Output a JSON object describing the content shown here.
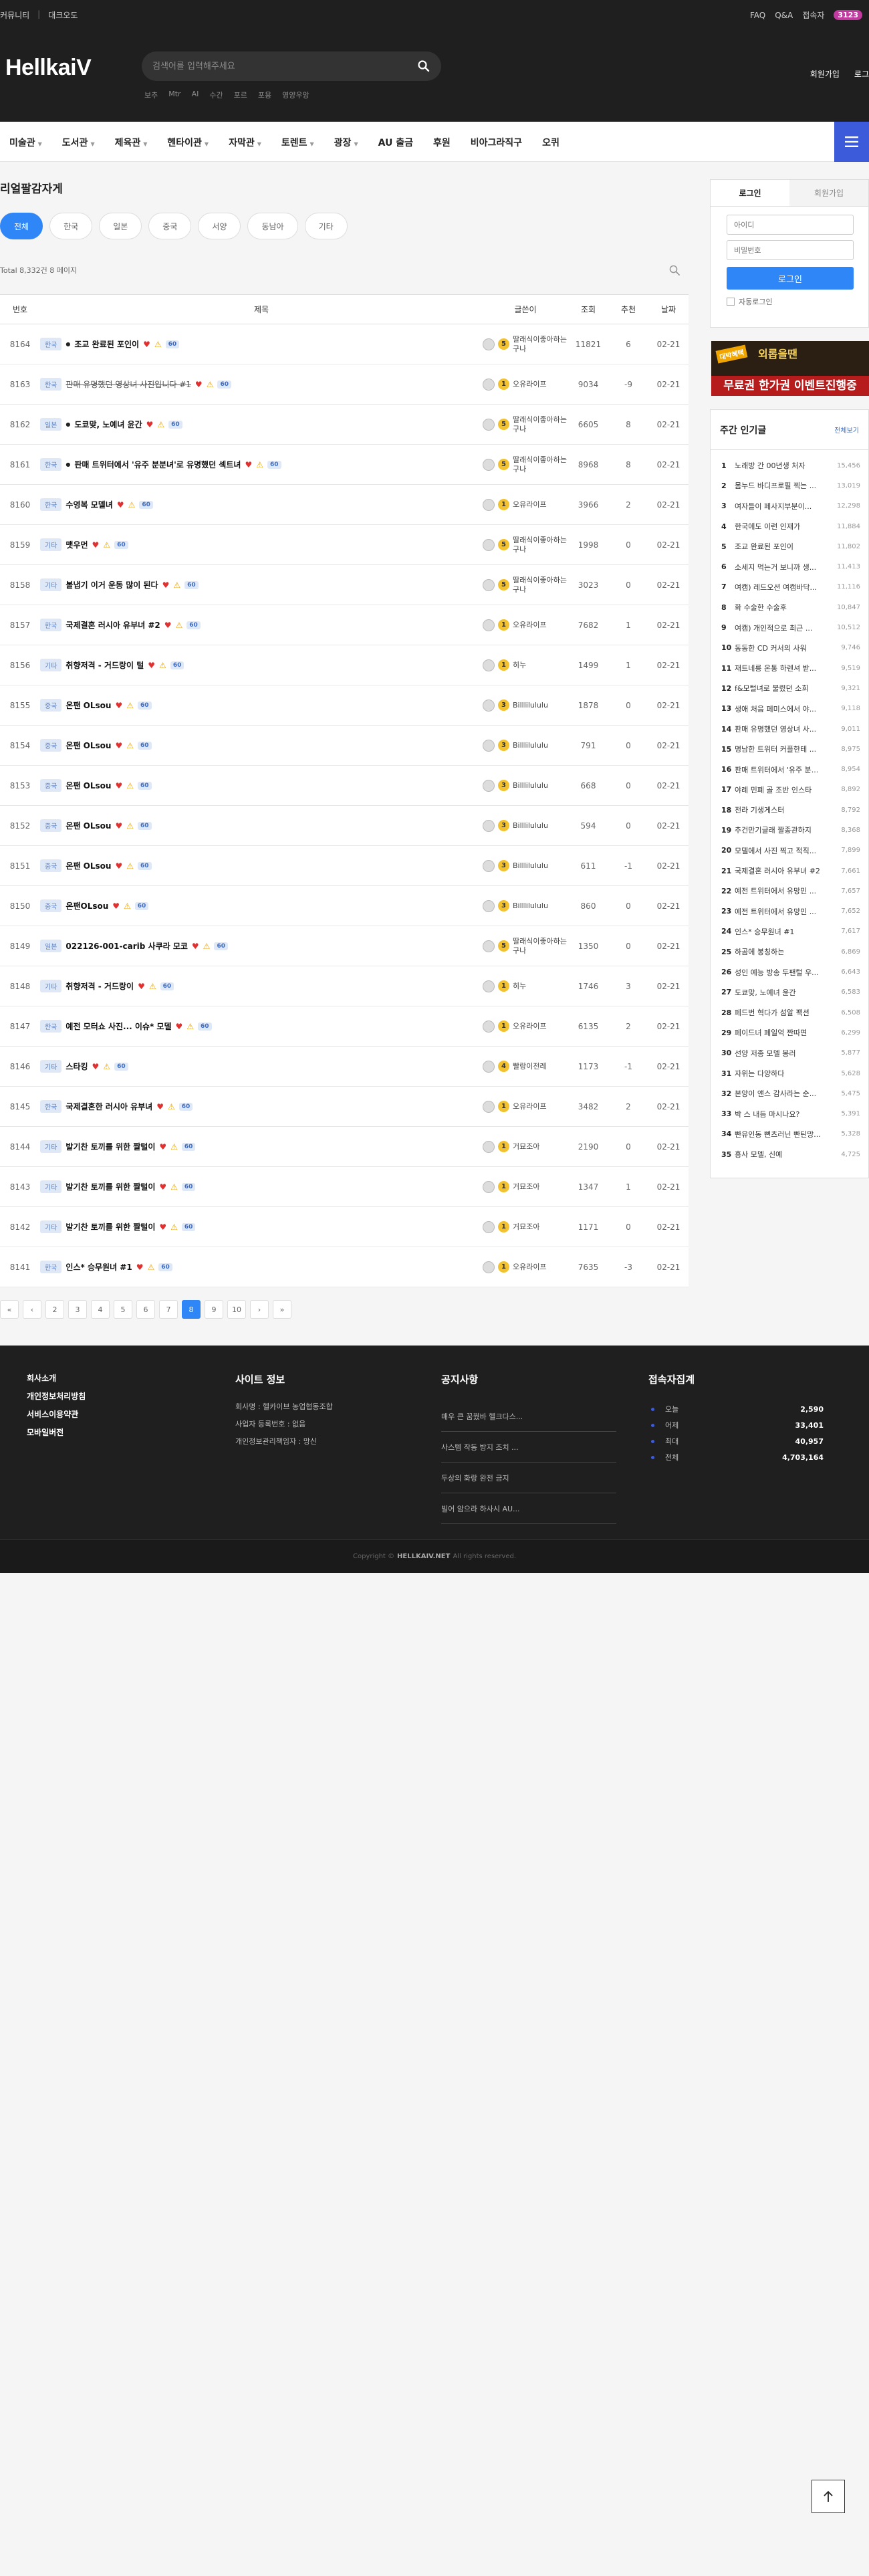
{
  "topbar": {
    "left": [
      "커뮤니티",
      "대크오도"
    ],
    "right": [
      "FAQ",
      "Q&A",
      "접속자"
    ],
    "online_count": "3123"
  },
  "header": {
    "logo": "HellkaiV",
    "search_placeholder": "검색어를 입력해주세요",
    "hot_keywords": [
      "보추",
      "Mtr",
      "AI",
      "수간",
      "포르",
      "포용",
      "영양우앙"
    ],
    "auth": [
      "회원가입",
      "로그"
    ]
  },
  "nav": {
    "items": [
      {
        "label": "미술관",
        "caret": true
      },
      {
        "label": "도서관",
        "caret": true
      },
      {
        "label": "제육관",
        "caret": true
      },
      {
        "label": "헨타이관",
        "caret": true
      },
      {
        "label": "자막관",
        "caret": true
      },
      {
        "label": "토렌트",
        "caret": true
      },
      {
        "label": "광장",
        "caret": true
      },
      {
        "label": "AU 출금",
        "caret": false
      },
      {
        "label": "후원",
        "caret": false
      },
      {
        "label": "비아그라직구",
        "caret": false
      },
      {
        "label": "오퀴",
        "caret": false
      }
    ]
  },
  "board": {
    "title": "리얼팔감자게",
    "categories": [
      "전체",
      "한국",
      "일본",
      "중국",
      "서양",
      "동남아",
      "기타"
    ],
    "active_category": "전체",
    "total": "Total 8,332건 8 페이지",
    "columns": [
      "번호",
      "제목",
      "글쓴이",
      "조회",
      "추천",
      "날짜"
    ],
    "rows": [
      {
        "no": "8164",
        "cat": "한국",
        "title": "조교 완료된 포인이",
        "strike": false,
        "dot": true,
        "heart": true,
        "warn": true,
        "new": "60",
        "author": "딸래식이좋아하는구나",
        "lvl": "5",
        "views": "11821",
        "rec": "6",
        "date": "02-21"
      },
      {
        "no": "8163",
        "cat": "한국",
        "title": "판매 유명했던 영상녀 사진입니다 #1",
        "strike": true,
        "dot": false,
        "heart": true,
        "warn": true,
        "new": "60",
        "author": "오유라이프",
        "lvl": "1",
        "views": "9034",
        "rec": "-9",
        "date": "02-21"
      },
      {
        "no": "8162",
        "cat": "일본",
        "title": "도쿄맞, 노예녀 윤간",
        "strike": false,
        "dot": true,
        "heart": true,
        "warn": true,
        "new": "60",
        "author": "딸래식이좋아하는구나",
        "lvl": "5",
        "views": "6605",
        "rec": "8",
        "date": "02-21"
      },
      {
        "no": "8161",
        "cat": "한국",
        "title": "판매 트위터에서 '유주 분분녀'로 유명했던 섹트녀",
        "strike": false,
        "dot": true,
        "heart": true,
        "warn": true,
        "new": "60",
        "author": "딸래식이좋아하는구나",
        "lvl": "5",
        "views": "8968",
        "rec": "8",
        "date": "02-21"
      },
      {
        "no": "8160",
        "cat": "한국",
        "title": "수영복 모델녀",
        "strike": false,
        "dot": false,
        "heart": true,
        "warn": true,
        "new": "60",
        "author": "오유라이프",
        "lvl": "1",
        "views": "3966",
        "rec": "2",
        "date": "02-21"
      },
      {
        "no": "8159",
        "cat": "기타",
        "title": "맷우먼",
        "strike": false,
        "dot": false,
        "heart": true,
        "warn": true,
        "new": "60",
        "author": "딸래식이좋아하는구나",
        "lvl": "5",
        "views": "1998",
        "rec": "0",
        "date": "02-21"
      },
      {
        "no": "8158",
        "cat": "기타",
        "title": "볼냅기 이거 운동 많이 된다",
        "strike": false,
        "dot": false,
        "heart": true,
        "warn": true,
        "new": "60",
        "author": "딸래식이좋아하는구나",
        "lvl": "5",
        "views": "3023",
        "rec": "0",
        "date": "02-21"
      },
      {
        "no": "8157",
        "cat": "한국",
        "title": "국제결혼 러시아 유부녀 #2",
        "strike": false,
        "dot": false,
        "heart": true,
        "warn": true,
        "new": "60",
        "author": "오유라이프",
        "lvl": "1",
        "views": "7682",
        "rec": "1",
        "date": "02-21"
      },
      {
        "no": "8156",
        "cat": "기타",
        "title": "취향저격 - 거드랑이 털",
        "strike": false,
        "dot": false,
        "heart": true,
        "warn": true,
        "new": "60",
        "author": "히누",
        "lvl": "1",
        "views": "1499",
        "rec": "1",
        "date": "02-21"
      },
      {
        "no": "8155",
        "cat": "중국",
        "title": "온팬 OLsou",
        "strike": false,
        "dot": false,
        "heart": true,
        "warn": true,
        "new": "60",
        "author": "Billlilululu",
        "lvl": "3",
        "views": "1878",
        "rec": "0",
        "date": "02-21"
      },
      {
        "no": "8154",
        "cat": "중국",
        "title": "온팬 OLsou",
        "strike": false,
        "dot": false,
        "heart": true,
        "warn": true,
        "new": "60",
        "author": "Billlilululu",
        "lvl": "3",
        "views": "791",
        "rec": "0",
        "date": "02-21"
      },
      {
        "no": "8153",
        "cat": "중국",
        "title": "온팬 OLsou",
        "strike": false,
        "dot": false,
        "heart": true,
        "warn": true,
        "new": "60",
        "author": "Billlilululu",
        "lvl": "3",
        "views": "668",
        "rec": "0",
        "date": "02-21"
      },
      {
        "no": "8152",
        "cat": "중국",
        "title": "온팬 OLsou",
        "strike": false,
        "dot": false,
        "heart": true,
        "warn": true,
        "new": "60",
        "author": "Billlilululu",
        "lvl": "3",
        "views": "594",
        "rec": "0",
        "date": "02-21"
      },
      {
        "no": "8151",
        "cat": "중국",
        "title": "온팬 OLsou",
        "strike": false,
        "dot": false,
        "heart": true,
        "warn": true,
        "new": "60",
        "author": "Billlilululu",
        "lvl": "3",
        "views": "611",
        "rec": "-1",
        "date": "02-21"
      },
      {
        "no": "8150",
        "cat": "중국",
        "title": "온팬OLsou",
        "strike": false,
        "dot": false,
        "heart": true,
        "warn": true,
        "new": "60",
        "author": "Billlilululu",
        "lvl": "3",
        "views": "860",
        "rec": "0",
        "date": "02-21"
      },
      {
        "no": "8149",
        "cat": "일본",
        "title": "022126-001-carib 사쿠라 모코",
        "strike": false,
        "dot": false,
        "heart": true,
        "warn": true,
        "new": "60",
        "author": "딸래식이좋아하는구나",
        "lvl": "5",
        "views": "1350",
        "rec": "0",
        "date": "02-21"
      },
      {
        "no": "8148",
        "cat": "기타",
        "title": "취향저격 - 거드랑이",
        "strike": false,
        "dot": false,
        "heart": true,
        "warn": true,
        "new": "60",
        "author": "히누",
        "lvl": "1",
        "views": "1746",
        "rec": "3",
        "date": "02-21"
      },
      {
        "no": "8147",
        "cat": "한국",
        "title": "예전 모터쇼 사진... 이슈* 모델",
        "strike": false,
        "dot": false,
        "heart": true,
        "warn": true,
        "new": "60",
        "author": "오유라이프",
        "lvl": "1",
        "views": "6135",
        "rec": "2",
        "date": "02-21"
      },
      {
        "no": "8146",
        "cat": "기타",
        "title": "스타킹",
        "strike": false,
        "dot": false,
        "heart": true,
        "warn": true,
        "new": "60",
        "author": "빨랑이전레",
        "lvl": "4",
        "views": "1173",
        "rec": "-1",
        "date": "02-21"
      },
      {
        "no": "8145",
        "cat": "한국",
        "title": "국제결혼한 러시아 유부녀",
        "strike": false,
        "dot": false,
        "heart": true,
        "warn": true,
        "new": "60",
        "author": "오유라이프",
        "lvl": "1",
        "views": "3482",
        "rec": "2",
        "date": "02-21"
      },
      {
        "no": "8144",
        "cat": "기타",
        "title": "발기찬 토끼를 위한 짤털이",
        "strike": false,
        "dot": false,
        "heart": true,
        "warn": true,
        "new": "60",
        "author": "거묘조아",
        "lvl": "1",
        "views": "2190",
        "rec": "0",
        "date": "02-21"
      },
      {
        "no": "8143",
        "cat": "기타",
        "title": "발기찬 토끼를 위한 짤털이",
        "strike": false,
        "dot": false,
        "heart": true,
        "warn": true,
        "new": "60",
        "author": "거묘조아",
        "lvl": "1",
        "views": "1347",
        "rec": "1",
        "date": "02-21"
      },
      {
        "no": "8142",
        "cat": "기타",
        "title": "발기찬 토끼를 위한 짤털이",
        "strike": false,
        "dot": false,
        "heart": true,
        "warn": true,
        "new": "60",
        "author": "거묘조아",
        "lvl": "1",
        "views": "1171",
        "rec": "0",
        "date": "02-21"
      },
      {
        "no": "8141",
        "cat": "한국",
        "title": "인스* 승무원녀 #1",
        "strike": false,
        "dot": false,
        "heart": true,
        "warn": true,
        "new": "60",
        "author": "오유라이프",
        "lvl": "1",
        "views": "7635",
        "rec": "-3",
        "date": "02-21"
      }
    ],
    "pager": [
      "«",
      "‹",
      "2",
      "3",
      "4",
      "5",
      "6",
      "7",
      "8",
      "9",
      "10",
      "›",
      "»"
    ],
    "current_page": "8"
  },
  "sidebar": {
    "login_tab": "로그인",
    "join_tab": "회원가입",
    "id_placeholder": "아이디",
    "pw_placeholder": "비밀번호",
    "login_button": "로그인",
    "auto_login": "자동로그인",
    "banner_text1": "외롭을땐",
    "banner_text2": "무료권 한가권 이벤트진행중",
    "banner_tag": "대박혜택",
    "popular_title": "주간 인기글",
    "popular_more": "전체보기",
    "popular": [
      {
        "rank": "1",
        "title": "노래방 간 00년생 처자",
        "views": "15,456"
      },
      {
        "rank": "2",
        "title": "몸누드 바디프로필 찍는 ...",
        "views": "13,019"
      },
      {
        "rank": "3",
        "title": "여자들이 페사지부분이...",
        "views": "12,298"
      },
      {
        "rank": "4",
        "title": "한국에도 이런 인재가",
        "views": "11,884"
      },
      {
        "rank": "5",
        "title": "조교 완료된 포인이",
        "views": "11,802"
      },
      {
        "rank": "6",
        "title": "소세지 먹는거 보니까 생...",
        "views": "11,413"
      },
      {
        "rank": "7",
        "title": "여캠) 레드오션 여캠바닥...",
        "views": "11,116"
      },
      {
        "rank": "8",
        "title": "화 수술한 수술후",
        "views": "10,847"
      },
      {
        "rank": "9",
        "title": "여캠) 개인적으로 최근 ...",
        "views": "10,512"
      },
      {
        "rank": "10",
        "title": "동동한 CD 커서의 사워",
        "views": "9,746"
      },
      {
        "rank": "11",
        "title": "재트네릉 온통 하렌셔 받...",
        "views": "9,519"
      },
      {
        "rank": "12",
        "title": "f&모털녀로 불렸던 소희",
        "views": "9,321"
      },
      {
        "rank": "13",
        "title": "생애 처음 페미스에서 야...",
        "views": "9,118"
      },
      {
        "rank": "14",
        "title": "판매 유명했던 영상녀 사...",
        "views": "9,011"
      },
      {
        "rank": "15",
        "title": "명남한 트위터 커플한테 ...",
        "views": "8,975"
      },
      {
        "rank": "16",
        "title": "판매 트위터에서 '유주 분...",
        "views": "8,954"
      },
      {
        "rank": "17",
        "title": "야례 민폐 골 조반 인스타",
        "views": "8,892"
      },
      {
        "rank": "18",
        "title": "전라 기생게스터",
        "views": "8,792"
      },
      {
        "rank": "19",
        "title": "추건만기글래 짤종관하지",
        "views": "8,368"
      },
      {
        "rank": "20",
        "title": "모델에서 사진 찍고 적직...",
        "views": "7,899"
      },
      {
        "rank": "21",
        "title": "국제결혼 러시아 유부녀 #2",
        "views": "7,661"
      },
      {
        "rank": "22",
        "title": "예전 트위터에서 유망민 ...",
        "views": "7,657"
      },
      {
        "rank": "23",
        "title": "예전 트위터에서 유망민 ...",
        "views": "7,652"
      },
      {
        "rank": "24",
        "title": "인스* 승무원녀 #1",
        "views": "7,617"
      },
      {
        "rank": "25",
        "title": "하곰에 봉칭하는",
        "views": "6,869"
      },
      {
        "rank": "26",
        "title": "성인 예능 방송 두팬털 우...",
        "views": "6,643"
      },
      {
        "rank": "27",
        "title": "도쿄맞, 노예녀 윤간",
        "views": "6,583"
      },
      {
        "rank": "28",
        "title": "페드번 혁다가 섬알 팩션",
        "views": "6,508"
      },
      {
        "rank": "29",
        "title": "페이드녀 페일억 짠따면",
        "views": "6,299"
      },
      {
        "rank": "30",
        "title": "선양 저종 모델 봉러",
        "views": "5,877"
      },
      {
        "rank": "31",
        "title": "자위는 다양하다",
        "views": "5,628"
      },
      {
        "rank": "32",
        "title": "본앙이 얜스 감사라는 순...",
        "views": "5,475"
      },
      {
        "rank": "33",
        "title": "박 스 내듬 마시나요?",
        "views": "5,391"
      },
      {
        "rank": "34",
        "title": "빤유인동 뻔츠러닌 빤틴망...",
        "views": "5,328"
      },
      {
        "rank": "35",
        "title": "흥사 모델, 신예",
        "views": "4,725"
      }
    ]
  },
  "footer": {
    "links": [
      "회사소개",
      "개인정보처리방침",
      "서비스이용약관",
      "모바일버전"
    ],
    "site_info_title": "사이트 정보",
    "site_info": [
      "회사명 : 헬카이브 농업협동조합",
      "사업자 등록번호 : 없음",
      "개인정보관리책임자 : 망신"
    ],
    "notice_title": "공지사항",
    "notices": [
      "매우 큰 꿈꿨바 헬크다스...",
      "사스템 작동 방지 조치 ...",
      "두상의 화랑 완전 금지",
      "빌어 암으라 하사시 AU..."
    ],
    "stats_title": "접속자집계",
    "stats": [
      {
        "label": "오늘",
        "value": "2,590"
      },
      {
        "label": "어제",
        "value": "33,401"
      },
      {
        "label": "최대",
        "value": "40,957"
      },
      {
        "label": "전체",
        "value": "4,703,164"
      }
    ],
    "copyright_pre": "Copyright ©",
    "copyright_brand": "HELLKAIV.NET",
    "copyright_post": "All rights reserved."
  },
  "colors": {
    "accent": "#2f86f6",
    "nav_button": "#3b5bdb",
    "dark": "#1f1f1f"
  }
}
